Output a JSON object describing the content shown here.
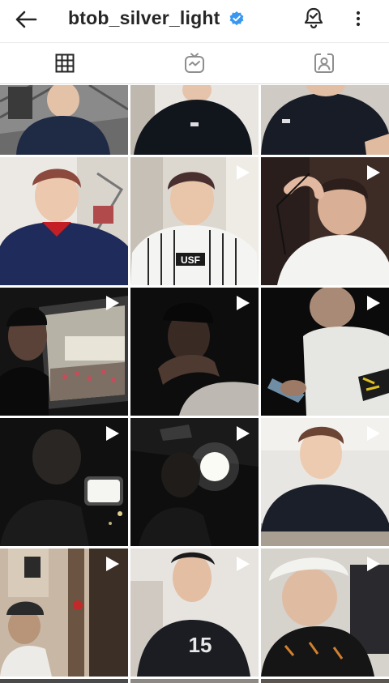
{
  "header": {
    "username": "btob_silver_light",
    "back_icon": "arrow-left-icon",
    "verified_icon": "verified-badge-icon",
    "notification_icon": "bell-check-icon",
    "more_icon": "vertical-dots-icon",
    "verified_color": "#3897f0"
  },
  "tabs": [
    {
      "name": "grid",
      "icon": "grid-icon",
      "active": true
    },
    {
      "name": "igtv",
      "icon": "igtv-icon",
      "active": false
    },
    {
      "name": "tagged",
      "icon": "tagged-person-icon",
      "active": false
    }
  ],
  "posts": [
    {
      "row": 0,
      "col": 0,
      "is_video": false
    },
    {
      "row": 0,
      "col": 1,
      "is_video": false
    },
    {
      "row": 0,
      "col": 2,
      "is_video": false
    },
    {
      "row": 1,
      "col": 0,
      "is_video": false
    },
    {
      "row": 1,
      "col": 1,
      "is_video": true
    },
    {
      "row": 1,
      "col": 2,
      "is_video": true
    },
    {
      "row": 2,
      "col": 0,
      "is_video": true
    },
    {
      "row": 2,
      "col": 1,
      "is_video": true
    },
    {
      "row": 2,
      "col": 2,
      "is_video": true
    },
    {
      "row": 3,
      "col": 0,
      "is_video": true
    },
    {
      "row": 3,
      "col": 1,
      "is_video": true
    },
    {
      "row": 3,
      "col": 2,
      "is_video": true
    },
    {
      "row": 4,
      "col": 0,
      "is_video": true
    },
    {
      "row": 4,
      "col": 1,
      "is_video": true
    },
    {
      "row": 4,
      "col": 2,
      "is_video": true
    }
  ],
  "shirt_text": {
    "post_5": "USF",
    "post_14": "15"
  }
}
